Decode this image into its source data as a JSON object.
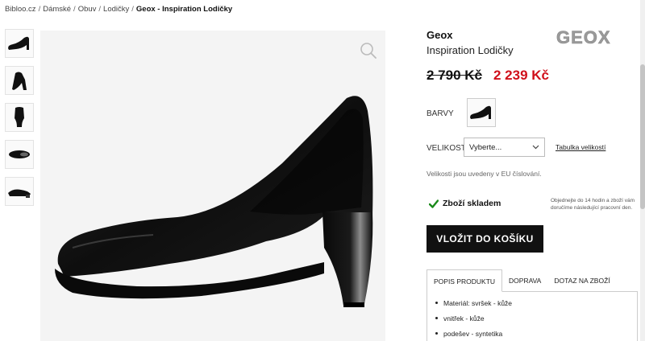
{
  "breadcrumb": {
    "items": [
      "Bibloo.cz",
      "Dámské",
      "Obuv",
      "Lodičky"
    ],
    "current": "Geox - Inspiration Lodičky"
  },
  "product": {
    "brand": "Geox",
    "name": "Inspiration Lodičky",
    "logo_text": "GEOX",
    "old_price": "2 790 Kč",
    "new_price": "2 239 Kč",
    "price_color": "#d0101b"
  },
  "colors": {
    "label": "BARVY"
  },
  "size": {
    "label": "VELIKOST",
    "selected": "Vyberte...",
    "table_link": "Tabulka velikostí",
    "note": "Velikosti jsou uvedeny v EU číslování."
  },
  "stock": {
    "label": "Zboží skladem",
    "delivery_note": "Objednejte do 14 hodin a zboží vám doručíme následující pracovní den."
  },
  "cart": {
    "button_label": "VLOŽIT DO KOŠÍKU"
  },
  "tabs": [
    {
      "label": "POPIS PRODUKTU",
      "active": true
    },
    {
      "label": "DOPRAVA",
      "active": false
    },
    {
      "label": "DOTAZ NA ZBOŽÍ",
      "active": false
    }
  ],
  "description": [
    "Materiál: svršek - kůže",
    "vnitřek - kůže",
    "podešev - syntetika"
  ],
  "icons": {
    "zoom": "magnifier-icon",
    "check": "check-icon",
    "dropdown": "chevron-down-icon"
  },
  "accent_colors": {
    "check": "#1a8a1a",
    "button": "#111111"
  }
}
